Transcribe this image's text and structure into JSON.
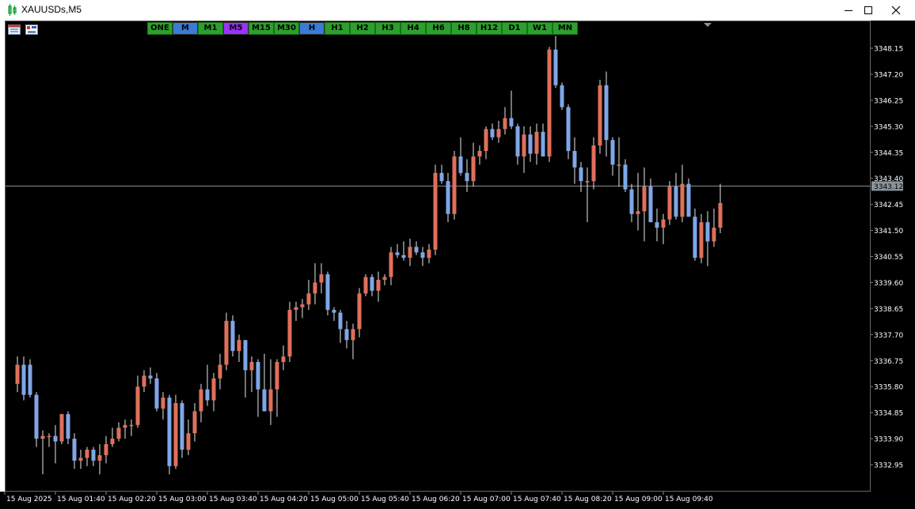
{
  "window": {
    "title": "XAUUSDs,M5"
  },
  "timeframes": [
    {
      "label": "ONE",
      "color": "#2ca02c"
    },
    {
      "label": "M",
      "color": "#3a7bd5"
    },
    {
      "label": "M1",
      "color": "#2ca02c"
    },
    {
      "label": "M5",
      "color": "#9b30ff"
    },
    {
      "label": "M15",
      "color": "#2ca02c"
    },
    {
      "label": "M30",
      "color": "#2ca02c"
    },
    {
      "label": "H",
      "color": "#3a7bd5"
    },
    {
      "label": "H1",
      "color": "#2ca02c"
    },
    {
      "label": "H2",
      "color": "#2ca02c"
    },
    {
      "label": "H3",
      "color": "#2ca02c"
    },
    {
      "label": "H4",
      "color": "#2ca02c"
    },
    {
      "label": "H6",
      "color": "#2ca02c"
    },
    {
      "label": "H8",
      "color": "#2ca02c"
    },
    {
      "label": "H12",
      "color": "#2ca02c"
    },
    {
      "label": "D1",
      "color": "#2ca02c"
    },
    {
      "label": "W1",
      "color": "#2ca02c"
    },
    {
      "label": "MN",
      "color": "#2ca02c"
    }
  ],
  "price_axis": {
    "labels": [
      "3348.15",
      "3347.20",
      "3346.25",
      "3345.30",
      "3344.35",
      "3343.40",
      "3342.45",
      "3341.50",
      "3340.55",
      "3339.60",
      "3338.65",
      "3337.70",
      "3336.75",
      "3335.80",
      "3334.85",
      "3333.90",
      "3332.95"
    ],
    "current_price": "3343.12"
  },
  "time_axis": {
    "labels": [
      "15 Aug 2025",
      "15 Aug 01:40",
      "15 Aug 02:20",
      "15 Aug 03:00",
      "15 Aug 03:40",
      "15 Aug 04:20",
      "15 Aug 05:00",
      "15 Aug 05:40",
      "15 Aug 06:20",
      "15 Aug 07:00",
      "15 Aug 07:40",
      "15 Aug 08:20",
      "15 Aug 09:00",
      "15 Aug 09:40"
    ]
  },
  "colors": {
    "bull": "#e0705a",
    "bear": "#7fa6e8",
    "wick": "#e8e8e8",
    "price_line": "#8a9299",
    "grid_text": "#ffffff"
  },
  "chart_data": {
    "type": "candlestick",
    "title": "XAUUSDs,M5",
    "ylim": [
      3332.5,
      3349.2
    ],
    "candles": [
      {
        "o": 3335.9,
        "h": 3336.9,
        "l": 3335.6,
        "c": 3336.6
      },
      {
        "o": 3336.6,
        "h": 3336.9,
        "l": 3335.3,
        "c": 3335.5
      },
      {
        "o": 3336.6,
        "h": 3336.8,
        "l": 3335.4,
        "c": 3335.5
      },
      {
        "o": 3335.5,
        "h": 3335.6,
        "l": 3333.6,
        "c": 3333.9
      },
      {
        "o": 3333.9,
        "h": 3334.2,
        "l": 3332.6,
        "c": 3334.0
      },
      {
        "o": 3334.0,
        "h": 3334.1,
        "l": 3333.6,
        "c": 3334.0
      },
      {
        "o": 3334.0,
        "h": 3334.4,
        "l": 3333.0,
        "c": 3333.8
      },
      {
        "o": 3333.8,
        "h": 3334.8,
        "l": 3333.7,
        "c": 3334.8
      },
      {
        "o": 3334.8,
        "h": 3334.9,
        "l": 3333.7,
        "c": 3333.9
      },
      {
        "o": 3333.9,
        "h": 3334.1,
        "l": 3332.8,
        "c": 3333.1
      },
      {
        "o": 3333.1,
        "h": 3333.5,
        "l": 3332.8,
        "c": 3333.2
      },
      {
        "o": 3333.2,
        "h": 3333.6,
        "l": 3332.9,
        "c": 3333.5
      },
      {
        "o": 3333.5,
        "h": 3333.6,
        "l": 3332.9,
        "c": 3333.1
      },
      {
        "o": 3333.1,
        "h": 3333.7,
        "l": 3332.6,
        "c": 3333.3
      },
      {
        "o": 3333.3,
        "h": 3334.0,
        "l": 3333.0,
        "c": 3333.7
      },
      {
        "o": 3333.7,
        "h": 3334.3,
        "l": 3333.6,
        "c": 3333.9
      },
      {
        "o": 3333.9,
        "h": 3334.5,
        "l": 3333.8,
        "c": 3334.3
      },
      {
        "o": 3334.3,
        "h": 3334.6,
        "l": 3333.9,
        "c": 3334.4
      },
      {
        "o": 3334.4,
        "h": 3334.6,
        "l": 3334.0,
        "c": 3334.4
      },
      {
        "o": 3334.4,
        "h": 3336.2,
        "l": 3334.3,
        "c": 3335.8
      },
      {
        "o": 3335.8,
        "h": 3336.4,
        "l": 3335.6,
        "c": 3336.2
      },
      {
        "o": 3336.2,
        "h": 3336.5,
        "l": 3335.9,
        "c": 3336.1
      },
      {
        "o": 3336.1,
        "h": 3336.3,
        "l": 3334.9,
        "c": 3335.0
      },
      {
        "o": 3335.0,
        "h": 3335.6,
        "l": 3334.6,
        "c": 3335.4
      },
      {
        "o": 3335.4,
        "h": 3335.5,
        "l": 3332.6,
        "c": 3332.9
      },
      {
        "o": 3332.9,
        "h": 3335.5,
        "l": 3332.8,
        "c": 3335.2
      },
      {
        "o": 3335.2,
        "h": 3335.3,
        "l": 3333.2,
        "c": 3333.5
      },
      {
        "o": 3333.5,
        "h": 3334.6,
        "l": 3333.3,
        "c": 3334.1
      },
      {
        "o": 3334.1,
        "h": 3335.2,
        "l": 3333.8,
        "c": 3334.9
      },
      {
        "o": 3334.9,
        "h": 3335.9,
        "l": 3334.5,
        "c": 3335.7
      },
      {
        "o": 3335.7,
        "h": 3336.6,
        "l": 3335.1,
        "c": 3335.3
      },
      {
        "o": 3335.3,
        "h": 3336.3,
        "l": 3334.9,
        "c": 3336.1
      },
      {
        "o": 3336.1,
        "h": 3337.0,
        "l": 3335.7,
        "c": 3336.6
      },
      {
        "o": 3336.6,
        "h": 3338.5,
        "l": 3336.4,
        "c": 3338.2
      },
      {
        "o": 3338.2,
        "h": 3338.4,
        "l": 3336.9,
        "c": 3337.1
      },
      {
        "o": 3337.1,
        "h": 3337.7,
        "l": 3336.7,
        "c": 3337.5
      },
      {
        "o": 3337.5,
        "h": 3337.5,
        "l": 3335.4,
        "c": 3336.4
      },
      {
        "o": 3336.4,
        "h": 3336.9,
        "l": 3335.6,
        "c": 3336.7
      },
      {
        "o": 3336.7,
        "h": 3336.8,
        "l": 3334.7,
        "c": 3335.7
      },
      {
        "o": 3335.7,
        "h": 3337.0,
        "l": 3334.9,
        "c": 3334.9
      },
      {
        "o": 3334.9,
        "h": 3336.8,
        "l": 3334.4,
        "c": 3335.7
      },
      {
        "o": 3335.7,
        "h": 3336.8,
        "l": 3334.7,
        "c": 3336.7
      },
      {
        "o": 3336.7,
        "h": 3337.3,
        "l": 3336.4,
        "c": 3336.9
      },
      {
        "o": 3336.9,
        "h": 3338.9,
        "l": 3336.7,
        "c": 3338.6
      },
      {
        "o": 3338.6,
        "h": 3338.9,
        "l": 3338.2,
        "c": 3338.7
      },
      {
        "o": 3338.7,
        "h": 3339.0,
        "l": 3338.3,
        "c": 3338.8
      },
      {
        "o": 3338.8,
        "h": 3339.7,
        "l": 3338.6,
        "c": 3339.2
      },
      {
        "o": 3339.2,
        "h": 3340.3,
        "l": 3338.8,
        "c": 3339.6
      },
      {
        "o": 3339.6,
        "h": 3340.3,
        "l": 3339.2,
        "c": 3339.9
      },
      {
        "o": 3339.9,
        "h": 3340.0,
        "l": 3338.4,
        "c": 3338.6
      },
      {
        "o": 3338.6,
        "h": 3338.7,
        "l": 3338.2,
        "c": 3338.5
      },
      {
        "o": 3338.5,
        "h": 3338.6,
        "l": 3337.4,
        "c": 3337.9
      },
      {
        "o": 3337.9,
        "h": 3338.2,
        "l": 3337.2,
        "c": 3337.5
      },
      {
        "o": 3337.5,
        "h": 3338.1,
        "l": 3336.8,
        "c": 3337.9
      },
      {
        "o": 3337.9,
        "h": 3339.4,
        "l": 3337.6,
        "c": 3339.2
      },
      {
        "o": 3339.2,
        "h": 3339.9,
        "l": 3339.1,
        "c": 3339.8
      },
      {
        "o": 3339.8,
        "h": 3339.9,
        "l": 3339.1,
        "c": 3339.3
      },
      {
        "o": 3339.3,
        "h": 3340.0,
        "l": 3338.9,
        "c": 3339.7
      },
      {
        "o": 3339.7,
        "h": 3339.9,
        "l": 3339.5,
        "c": 3339.8
      },
      {
        "o": 3339.8,
        "h": 3340.9,
        "l": 3339.5,
        "c": 3340.7
      },
      {
        "o": 3340.7,
        "h": 3341.0,
        "l": 3340.5,
        "c": 3340.6
      },
      {
        "o": 3340.6,
        "h": 3341.1,
        "l": 3340.4,
        "c": 3340.5
      },
      {
        "o": 3340.5,
        "h": 3341.2,
        "l": 3340.2,
        "c": 3340.9
      },
      {
        "o": 3340.9,
        "h": 3341.1,
        "l": 3340.6,
        "c": 3340.7
      },
      {
        "o": 3340.7,
        "h": 3340.9,
        "l": 3340.2,
        "c": 3340.5
      },
      {
        "o": 3340.5,
        "h": 3341.0,
        "l": 3340.3,
        "c": 3340.8
      },
      {
        "o": 3340.8,
        "h": 3343.9,
        "l": 3340.6,
        "c": 3343.6
      },
      {
        "o": 3343.6,
        "h": 3343.9,
        "l": 3343.2,
        "c": 3343.3
      },
      {
        "o": 3343.3,
        "h": 3343.6,
        "l": 3341.8,
        "c": 3342.1
      },
      {
        "o": 3342.1,
        "h": 3344.4,
        "l": 3341.9,
        "c": 3344.2
      },
      {
        "o": 3344.2,
        "h": 3344.9,
        "l": 3343.5,
        "c": 3343.6
      },
      {
        "o": 3343.6,
        "h": 3344.1,
        "l": 3342.9,
        "c": 3343.3
      },
      {
        "o": 3343.3,
        "h": 3344.7,
        "l": 3343.1,
        "c": 3344.2
      },
      {
        "o": 3344.2,
        "h": 3344.6,
        "l": 3343.9,
        "c": 3344.4
      },
      {
        "o": 3344.4,
        "h": 3345.3,
        "l": 3344.1,
        "c": 3345.2
      },
      {
        "o": 3345.2,
        "h": 3345.4,
        "l": 3344.8,
        "c": 3344.9
      },
      {
        "o": 3344.9,
        "h": 3345.5,
        "l": 3344.7,
        "c": 3345.2
      },
      {
        "o": 3345.2,
        "h": 3346.0,
        "l": 3345.0,
        "c": 3345.6
      },
      {
        "o": 3345.6,
        "h": 3346.6,
        "l": 3345.2,
        "c": 3345.3
      },
      {
        "o": 3345.3,
        "h": 3345.4,
        "l": 3343.9,
        "c": 3344.2
      },
      {
        "o": 3344.2,
        "h": 3345.3,
        "l": 3343.6,
        "c": 3345.0
      },
      {
        "o": 3345.0,
        "h": 3345.3,
        "l": 3344.0,
        "c": 3344.3
      },
      {
        "o": 3344.3,
        "h": 3345.4,
        "l": 3343.9,
        "c": 3345.1
      },
      {
        "o": 3345.1,
        "h": 3345.4,
        "l": 3344.2,
        "c": 3344.2
      },
      {
        "o": 3344.2,
        "h": 3348.2,
        "l": 3344.0,
        "c": 3348.1
      },
      {
        "o": 3348.1,
        "h": 3348.6,
        "l": 3346.7,
        "c": 3346.8
      },
      {
        "o": 3346.8,
        "h": 3346.9,
        "l": 3345.9,
        "c": 3346.0
      },
      {
        "o": 3346.0,
        "h": 3346.1,
        "l": 3344.1,
        "c": 3344.4
      },
      {
        "o": 3344.4,
        "h": 3344.9,
        "l": 3343.2,
        "c": 3343.8
      },
      {
        "o": 3343.8,
        "h": 3344.0,
        "l": 3342.9,
        "c": 3343.3
      },
      {
        "o": 3343.3,
        "h": 3343.8,
        "l": 3341.8,
        "c": 3343.3
      },
      {
        "o": 3343.3,
        "h": 3344.9,
        "l": 3343.0,
        "c": 3344.6
      },
      {
        "o": 3344.6,
        "h": 3347.0,
        "l": 3344.3,
        "c": 3346.8
      },
      {
        "o": 3346.8,
        "h": 3347.3,
        "l": 3344.2,
        "c": 3344.8
      },
      {
        "o": 3344.8,
        "h": 3344.9,
        "l": 3343.5,
        "c": 3343.9
      },
      {
        "o": 3343.9,
        "h": 3344.9,
        "l": 3343.1,
        "c": 3343.9
      },
      {
        "o": 3343.9,
        "h": 3344.1,
        "l": 3342.9,
        "c": 3343.0
      },
      {
        "o": 3343.0,
        "h": 3343.2,
        "l": 3341.8,
        "c": 3342.1
      },
      {
        "o": 3342.1,
        "h": 3343.6,
        "l": 3341.5,
        "c": 3342.2
      },
      {
        "o": 3342.2,
        "h": 3343.8,
        "l": 3341.1,
        "c": 3343.1
      },
      {
        "o": 3343.1,
        "h": 3343.4,
        "l": 3341.9,
        "c": 3341.8
      },
      {
        "o": 3341.8,
        "h": 3342.3,
        "l": 3341.1,
        "c": 3341.6
      },
      {
        "o": 3341.6,
        "h": 3342.1,
        "l": 3341.0,
        "c": 3341.9
      },
      {
        "o": 3341.9,
        "h": 3343.3,
        "l": 3341.7,
        "c": 3343.1
      },
      {
        "o": 3343.1,
        "h": 3343.6,
        "l": 3341.9,
        "c": 3342.0
      },
      {
        "o": 3342.0,
        "h": 3343.9,
        "l": 3341.8,
        "c": 3343.2
      },
      {
        "o": 3343.2,
        "h": 3343.4,
        "l": 3342.0,
        "c": 3342.0
      },
      {
        "o": 3342.0,
        "h": 3342.3,
        "l": 3340.4,
        "c": 3340.5
      },
      {
        "o": 3340.5,
        "h": 3342.1,
        "l": 3340.3,
        "c": 3341.8
      },
      {
        "o": 3341.8,
        "h": 3342.2,
        "l": 3340.2,
        "c": 3341.1
      },
      {
        "o": 3341.1,
        "h": 3342.3,
        "l": 3340.9,
        "c": 3341.6
      },
      {
        "o": 3341.6,
        "h": 3343.2,
        "l": 3341.4,
        "c": 3342.5
      }
    ]
  }
}
